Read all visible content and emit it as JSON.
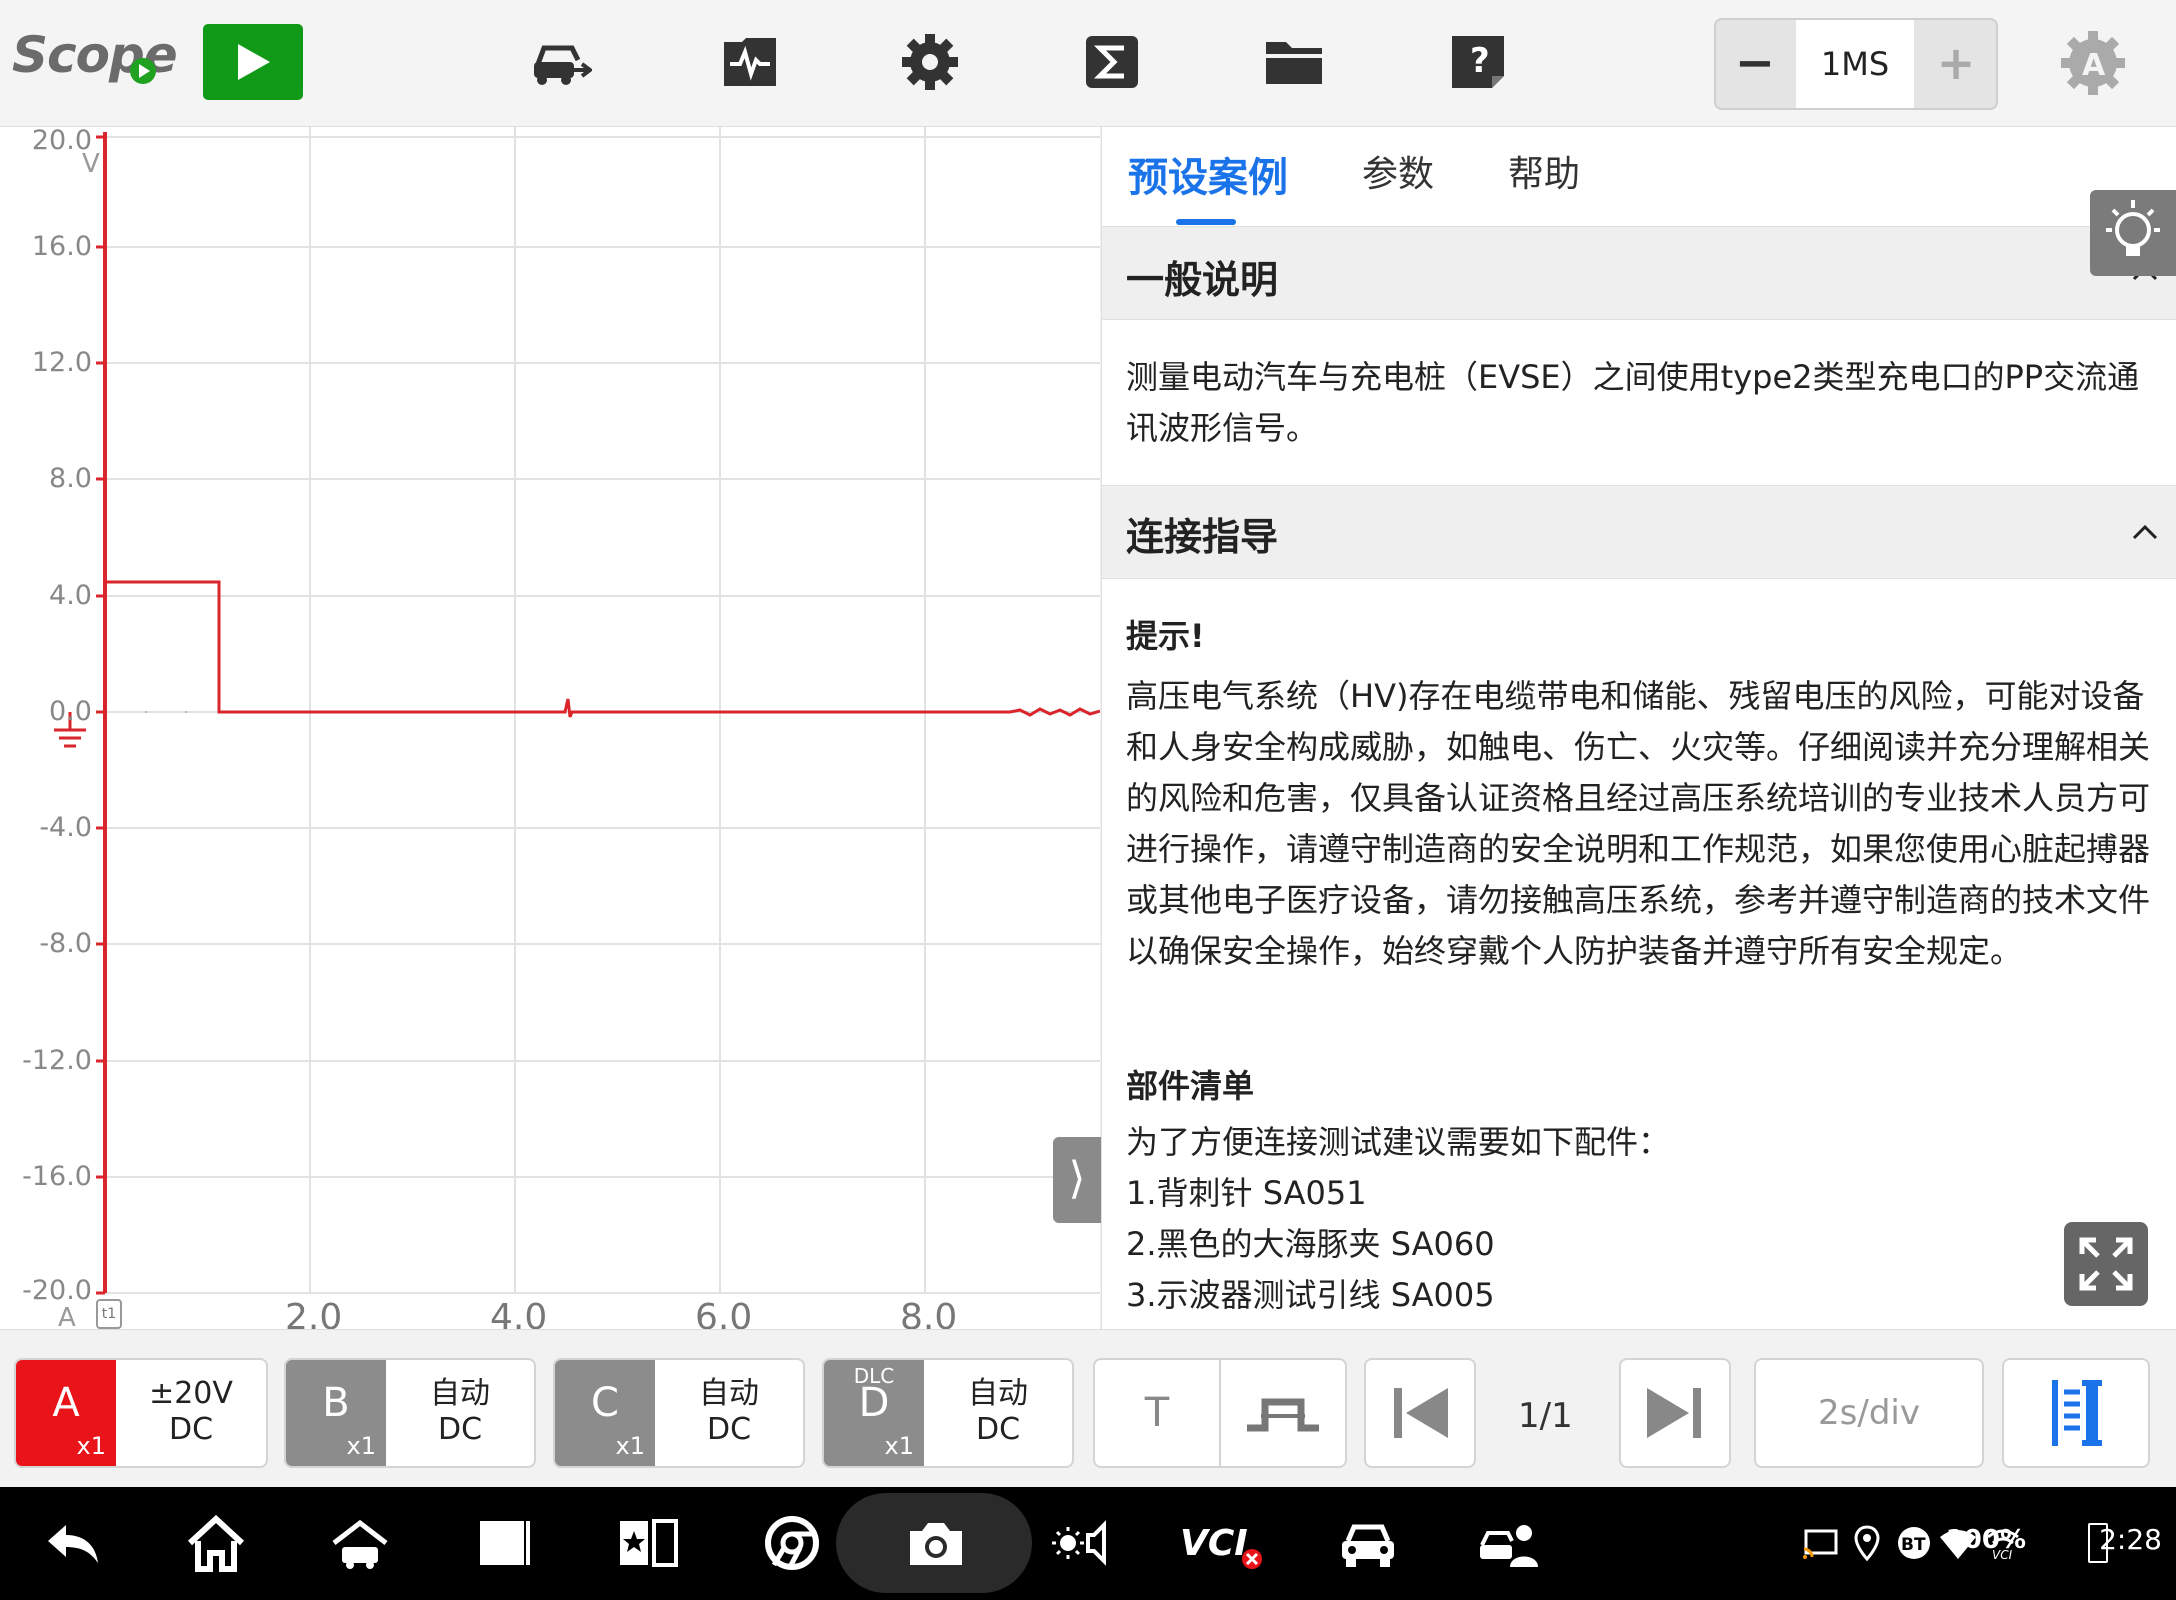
{
  "app": {
    "logo": "Scope"
  },
  "toolbar": {
    "icons": [
      "vehicle-swap-icon",
      "waveform-library-icon",
      "settings-icon",
      "math-sigma-icon",
      "folder-icon",
      "help-icon"
    ],
    "sample_rate": {
      "minus": "−",
      "value": "1MS",
      "plus": "+"
    }
  },
  "plot": {
    "y_unit": "V",
    "y_ticks": [
      "20.0",
      "16.0",
      "12.0",
      "8.0",
      "4.0",
      "0.0",
      "-4.0",
      "-8.0",
      "-12.0",
      "-16.0",
      "-20.0"
    ],
    "x_ticks": [
      "2.0",
      "4.0",
      "6.0",
      "8.0"
    ],
    "channel_marker": "A",
    "cursor_label": "t1",
    "trace_color": "#d9252b"
  },
  "panel": {
    "tabs": [
      "预设案例",
      "参数",
      "帮助"
    ],
    "sections": {
      "general_title": "一般说明",
      "general_text": "测量电动汽车与充电桩（EVSE）之间使用type2类型充电口的PP交流通讯波形信号。",
      "connect_title": "连接指导",
      "tip_title": "提示!",
      "tip_text": "高压电气系统（HV)存在电缆带电和储能、残留电压的风险，可能对设备和人身安全构成威胁，如触电、伤亡、火灾等。仔细阅读并充分理解相关的风险和危害，仅具备认证资格且经过高压系统培训的专业技术人员方可进行操作，请遵守制造商的安全说明和工作规范，如果您使用心脏起搏器或其他电子医疗设备，请勿接触高压系统，参考并遵守制造商的技术文件以确保安全操作，始终穿戴个人防护装备并遵守所有安全规定。",
      "parts_title": "部件清单",
      "parts_intro": "为了方便连接测试建议需要如下配件：",
      "parts": [
        "1.背刺针 SA051",
        "2.黑色的大海豚夹 SA060",
        "3.示波器测试引线 SA005"
      ]
    }
  },
  "channels": [
    {
      "letter": "A",
      "mult": "x1",
      "line1": "±20V",
      "line2": "DC",
      "color": "#e8141a",
      "dlc": ""
    },
    {
      "letter": "B",
      "mult": "x1",
      "line1": "自动",
      "line2": "DC",
      "color": "#8c8c8c",
      "dlc": ""
    },
    {
      "letter": "C",
      "mult": "x1",
      "line1": "自动",
      "line2": "DC",
      "color": "#8c8c8c",
      "dlc": ""
    },
    {
      "letter": "D",
      "mult": "x1",
      "line1": "自动",
      "line2": "DC",
      "color": "#8c8c8c",
      "dlc": "DLC"
    }
  ],
  "controls": {
    "trigger_label": "T",
    "page_indicator": "1/1",
    "timebase": "2s/div"
  },
  "status": {
    "battery": "100%",
    "time": "2:28"
  }
}
